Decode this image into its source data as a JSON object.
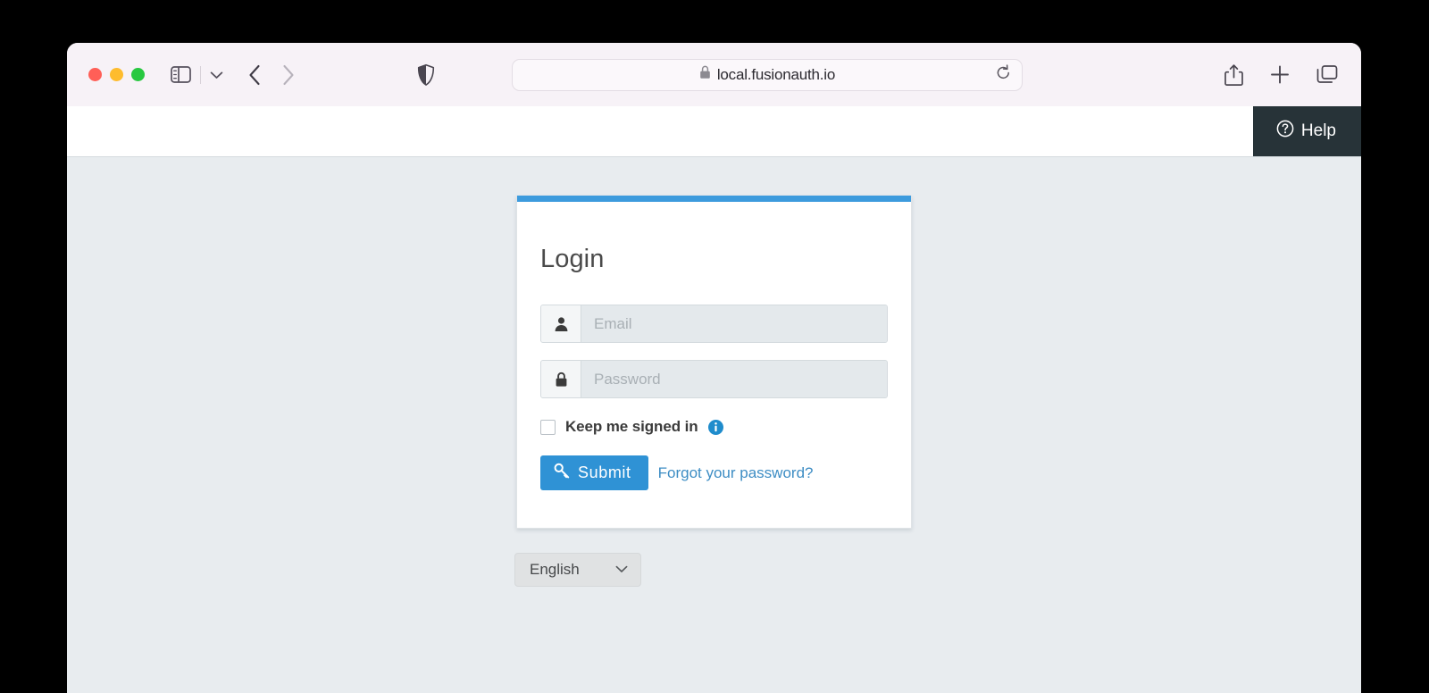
{
  "browser": {
    "traffic_lights": [
      "close",
      "minimize",
      "maximize"
    ],
    "sidebar_icon": "sidebar-icon",
    "sidebar_chevron_icon": "chevron-down-icon",
    "back_icon": "chevron-left-icon",
    "forward_icon": "chevron-right-icon",
    "shield_icon": "privacy-shield-icon",
    "url": "local.fusionauth.io",
    "url_lock_icon": "lock-icon",
    "reload_icon": "reload-icon",
    "share_icon": "share-icon",
    "new_tab_icon": "plus-icon",
    "tabs_icon": "tab-overview-icon"
  },
  "page_header": {
    "help_label": "Help",
    "help_icon": "question-circle-icon"
  },
  "login": {
    "title": "Login",
    "accent_color": "#3d9bdd",
    "email": {
      "placeholder": "Email",
      "value": "",
      "icon": "user-icon"
    },
    "password": {
      "placeholder": "Password",
      "value": "",
      "icon": "lock-icon"
    },
    "keep_signed_in": {
      "label": "Keep me signed in",
      "checked": false,
      "info_icon": "info-circle-icon"
    },
    "submit": {
      "label": "Submit",
      "icon": "key-icon",
      "color": "#2f92d5"
    },
    "forgot_password_label": "Forgot your password?"
  },
  "language_select": {
    "value": "English",
    "chevron_icon": "chevron-down-icon"
  }
}
